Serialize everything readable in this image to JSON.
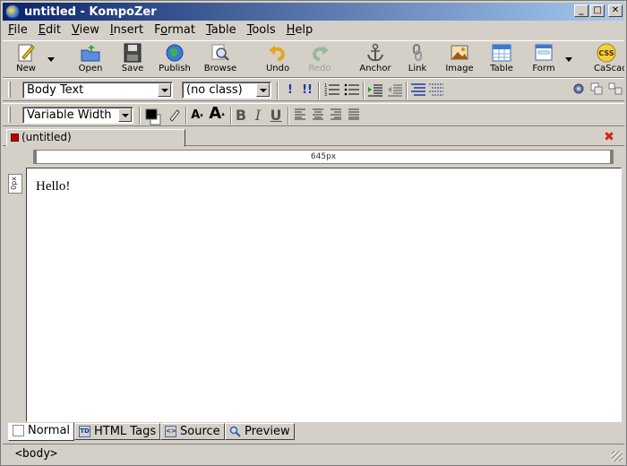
{
  "window": {
    "title": "untitled - KompoZer"
  },
  "menu": [
    {
      "key": "F",
      "rest": "ile"
    },
    {
      "key": "E",
      "rest": "dit"
    },
    {
      "key": "V",
      "rest": "iew"
    },
    {
      "key": "I",
      "rest": "nsert"
    },
    {
      "pre": "F",
      "key": "o",
      "rest": "rmat"
    },
    {
      "key": "T",
      "rest": "able"
    },
    {
      "key": "T",
      "rest": "ools"
    },
    {
      "key": "H",
      "rest": "elp"
    }
  ],
  "toolbar": {
    "new": "New",
    "open": "Open",
    "save": "Save",
    "publish": "Publish",
    "browse": "Browse",
    "undo": "Undo",
    "redo": "Redo",
    "anchor": "Anchor",
    "link": "Link",
    "image": "Image",
    "table": "Table",
    "form": "Form",
    "cascades": "CaScades"
  },
  "format1": {
    "paragraph_format": "Body Text",
    "class": "(no class)"
  },
  "format2": {
    "font_face": "Variable Width"
  },
  "colors": {
    "title_start": "#0a246a",
    "title_end": "#a6caf0",
    "tab_close": "#d82020"
  },
  "document_tab": {
    "label": "(untitled)"
  },
  "ruler": {
    "width_label": "645px",
    "height_label": "0px"
  },
  "editor": {
    "content": "Hello!"
  },
  "mode_tabs": {
    "normal": "Normal",
    "html_tags": "HTML Tags",
    "source": "Source",
    "preview": "Preview"
  },
  "status": {
    "path": "<body>"
  }
}
